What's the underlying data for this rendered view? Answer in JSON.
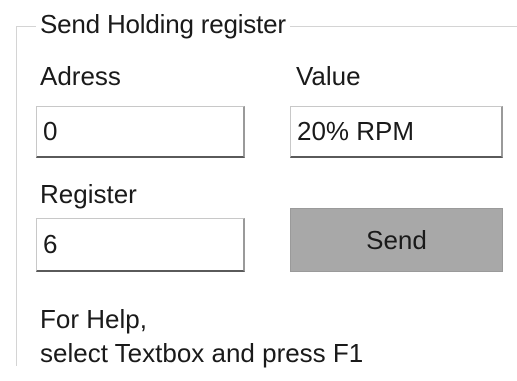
{
  "group": {
    "title": "Send Holding register"
  },
  "fields": {
    "address_label": "Adress",
    "address_value": "0",
    "value_label": "Value",
    "value_value": "20% RPM",
    "register_label": "Register",
    "register_value": "6"
  },
  "send_button": {
    "label": "Send",
    "color": "#a8a8a8"
  },
  "help": {
    "line1": "For Help,",
    "line2": "select Textbox and press F1"
  }
}
